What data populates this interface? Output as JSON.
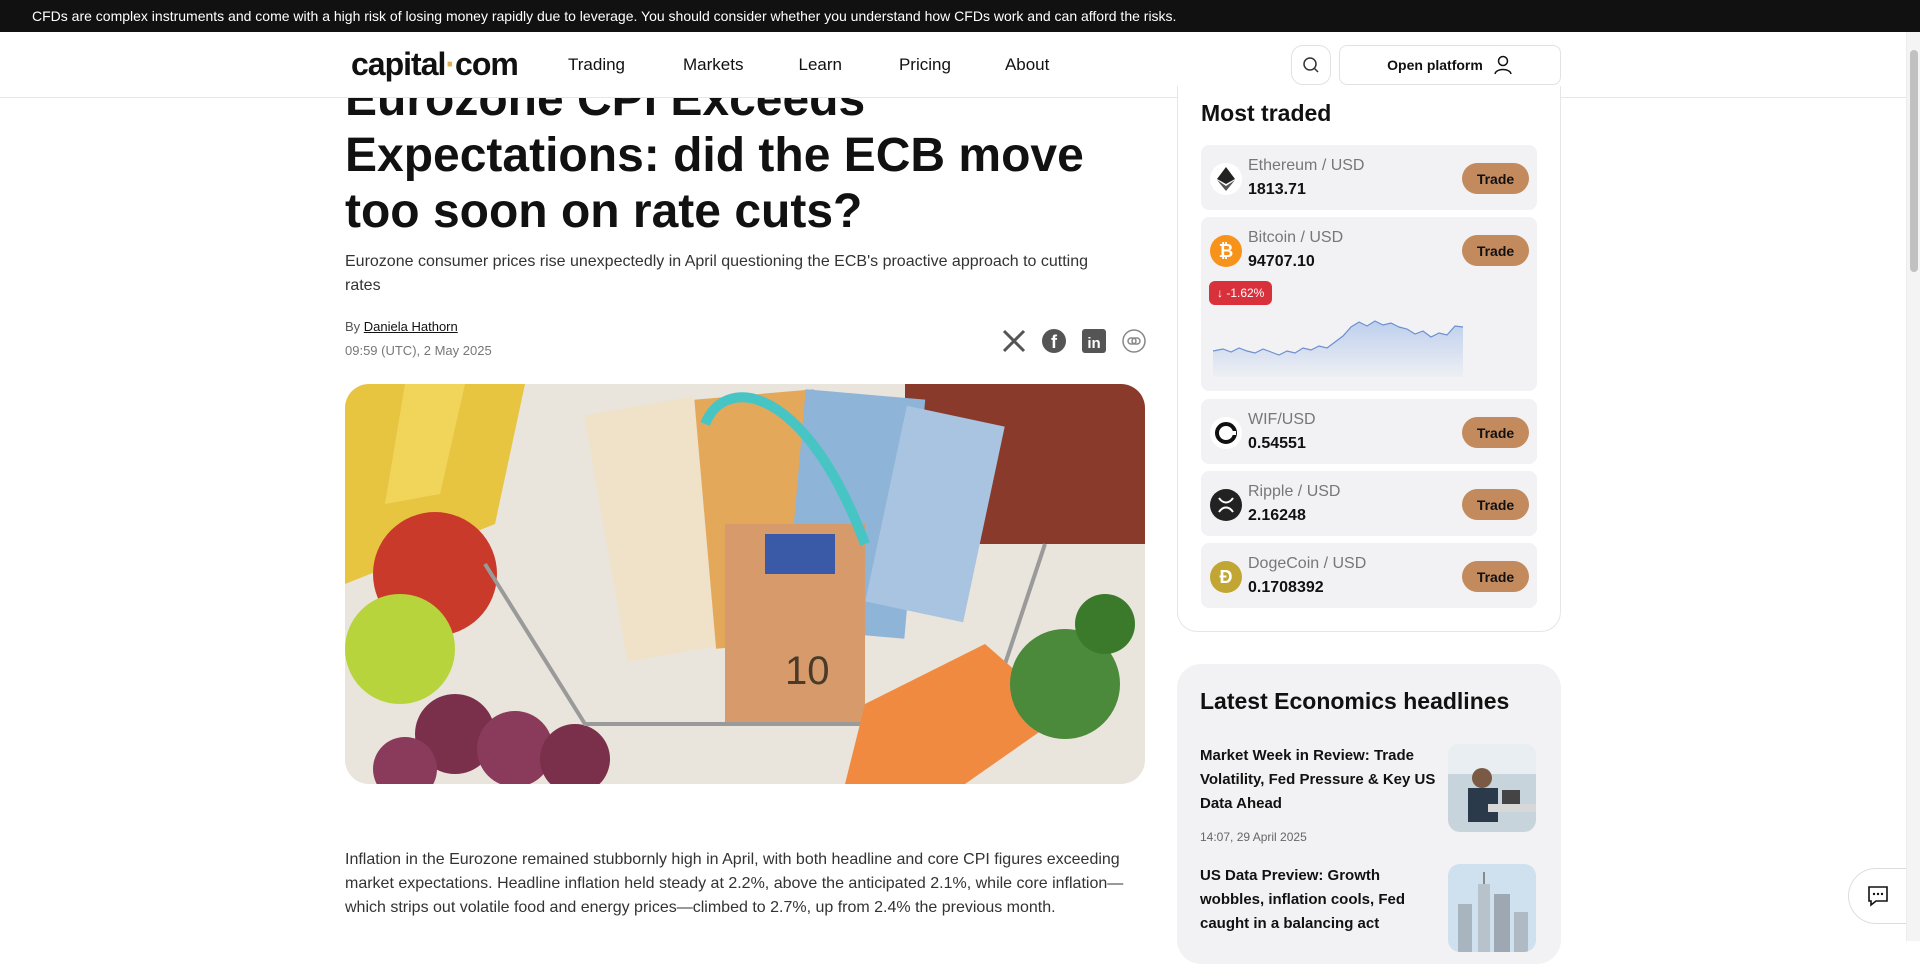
{
  "risk_warning": "CFDs are complex instruments and come with a high risk of losing money rapidly due to leverage. You should consider whether you understand how CFDs work and can afford the risks.",
  "header": {
    "logo_left": "capital",
    "logo_dot": "·",
    "logo_right": "com",
    "nav": [
      "Trading",
      "Markets",
      "Learn",
      "Pricing",
      "About"
    ],
    "open_platform": "Open platform"
  },
  "article": {
    "title": "Eurozone CPI Exceeds Expectations: did the ECB move too soon on rate cuts?",
    "subtitle": "Eurozone consumer prices rise unexpectedly in April questioning the ECB's proactive approach to cutting rates",
    "by": "By",
    "author": "Daniela Hathorn",
    "date": "09:59 (UTC), 2 May 2025",
    "body": "Inflation in the Eurozone remained stubbornly high in April, with both headline and core CPI figures exceeding market expectations. Headline inflation held steady at 2.2%, above the anticipated 2.1%, while core inflation—which strips out volatile food and energy prices—climbed to 2.7%, up from 2.4% the previous month."
  },
  "most_traded": {
    "title": "Most traded",
    "trade_label": "Trade",
    "items": [
      {
        "name": "Ethereum / USD",
        "price": "1813.71",
        "icon": "ethereum-icon"
      },
      {
        "name": "Bitcoin / USD",
        "price": "94707.10",
        "icon": "bitcoin-icon",
        "change": "↓ -1.62%"
      },
      {
        "name": "WIF/USD",
        "price": "0.54551",
        "icon": "wif-icon"
      },
      {
        "name": "Ripple / USD",
        "price": "2.16248",
        "icon": "ripple-icon"
      },
      {
        "name": "DogeCoin / USD",
        "price": "0.1708392",
        "icon": "dogecoin-icon"
      }
    ]
  },
  "headlines": {
    "title": "Latest Economics headlines",
    "items": [
      {
        "title": "Market Week in Review: Trade Volatility, Fed Pressure & Key US Data Ahead",
        "date": "14:07, 29 April 2025"
      },
      {
        "title": "US Data Preview: Growth wobbles, inflation cools, Fed caught in a balancing act",
        "date": ""
      }
    ]
  },
  "colors": {
    "trade_button": "#c38a5d",
    "negative": "#d9313b",
    "risk_bar": "#111111"
  }
}
